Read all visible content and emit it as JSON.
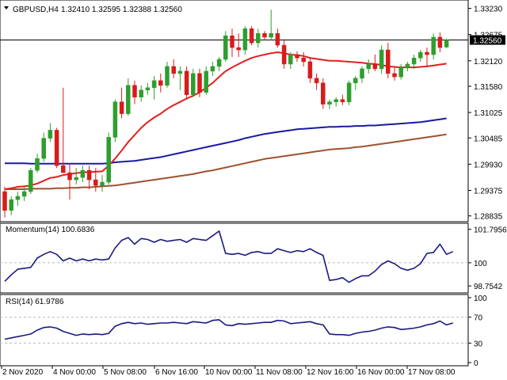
{
  "header": {
    "symbol_timeframe": "GBPUSD,H4",
    "ohlc": "1.32410 1.32595 1.32388 1.32560"
  },
  "price_axis": {
    "ticks": [
      "1.33230",
      "1.32675",
      "1.32120",
      "1.31580",
      "1.31025",
      "1.30485",
      "1.29930",
      "1.29375",
      "1.28835"
    ],
    "current_price": "1.32560"
  },
  "momentum": {
    "label": "Momentum(14) 100.6836",
    "ticks": [
      "101.7956",
      "100",
      "98.7542"
    ]
  },
  "rsi": {
    "label": "RSI(14) 61.9786",
    "ticks": [
      "100",
      "70",
      "30",
      "0"
    ]
  },
  "time_axis": {
    "labels": [
      "2 Nov 2020",
      "4 Nov 00:00",
      "5 Nov 08:00",
      "6 Nov 16:00",
      "10 Nov 00:00",
      "11 Nov 08:00",
      "12 Nov 16:00",
      "16 Nov 00:00",
      "17 Nov 08:00"
    ]
  },
  "colors": {
    "bull": "#2e9e2e",
    "bear": "#d81b1b",
    "sma_fast": "#e02020",
    "sma_mid": "#1a1aa0",
    "sma_slow": "#a0522d",
    "indicator": "#1a1a80",
    "grid": "#bbbbbb"
  },
  "chart_data": {
    "type": "candlestick",
    "price_scale": {
      "min": 1.2878,
      "max": 1.3334
    },
    "candles": [
      {
        "o": 1.2935,
        "h": 1.2945,
        "l": 1.288,
        "c": 1.2895
      },
      {
        "o": 1.2895,
        "h": 1.2925,
        "l": 1.2885,
        "c": 1.2918
      },
      {
        "o": 1.2918,
        "h": 1.2935,
        "l": 1.2905,
        "c": 1.2925
      },
      {
        "o": 1.2925,
        "h": 1.2945,
        "l": 1.2915,
        "c": 1.2935
      },
      {
        "o": 1.2935,
        "h": 1.2985,
        "l": 1.293,
        "c": 1.298
      },
      {
        "o": 1.298,
        "h": 1.3015,
        "l": 1.2975,
        "c": 1.3005
      },
      {
        "o": 1.3005,
        "h": 1.306,
        "l": 1.2998,
        "c": 1.3048
      },
      {
        "o": 1.3048,
        "h": 1.308,
        "l": 1.304,
        "c": 1.3065
      },
      {
        "o": 1.3065,
        "h": 1.307,
        "l": 1.2985,
        "c": 1.299
      },
      {
        "o": 1.299,
        "h": 1.3155,
        "l": 1.2975,
        "c": 1.2975
      },
      {
        "o": 1.2975,
        "h": 1.2995,
        "l": 1.2918,
        "c": 1.296
      },
      {
        "o": 1.296,
        "h": 1.2985,
        "l": 1.295,
        "c": 1.2965
      },
      {
        "o": 1.2965,
        "h": 1.299,
        "l": 1.2955,
        "c": 1.298
      },
      {
        "o": 1.298,
        "h": 1.299,
        "l": 1.294,
        "c": 1.296
      },
      {
        "o": 1.296,
        "h": 1.2985,
        "l": 1.2935,
        "c": 1.2948
      },
      {
        "o": 1.2948,
        "h": 1.297,
        "l": 1.2935,
        "c": 1.2955
      },
      {
        "o": 1.2955,
        "h": 1.306,
        "l": 1.295,
        "c": 1.305
      },
      {
        "o": 1.305,
        "h": 1.313,
        "l": 1.304,
        "c": 1.3125
      },
      {
        "o": 1.3125,
        "h": 1.3155,
        "l": 1.309,
        "c": 1.31
      },
      {
        "o": 1.31,
        "h": 1.3175,
        "l": 1.3095,
        "c": 1.316
      },
      {
        "o": 1.316,
        "h": 1.317,
        "l": 1.312,
        "c": 1.3135
      },
      {
        "o": 1.3135,
        "h": 1.316,
        "l": 1.3125,
        "c": 1.315
      },
      {
        "o": 1.315,
        "h": 1.3165,
        "l": 1.314,
        "c": 1.3155
      },
      {
        "o": 1.3155,
        "h": 1.318,
        "l": 1.313,
        "c": 1.317
      },
      {
        "o": 1.317,
        "h": 1.3185,
        "l": 1.3145,
        "c": 1.316
      },
      {
        "o": 1.316,
        "h": 1.321,
        "l": 1.3155,
        "c": 1.32
      },
      {
        "o": 1.32,
        "h": 1.3215,
        "l": 1.3175,
        "c": 1.3185
      },
      {
        "o": 1.3185,
        "h": 1.32,
        "l": 1.315,
        "c": 1.319
      },
      {
        "o": 1.319,
        "h": 1.32,
        "l": 1.313,
        "c": 1.314
      },
      {
        "o": 1.314,
        "h": 1.3195,
        "l": 1.3135,
        "c": 1.3185
      },
      {
        "o": 1.3185,
        "h": 1.3195,
        "l": 1.3135,
        "c": 1.3145
      },
      {
        "o": 1.3145,
        "h": 1.32,
        "l": 1.314,
        "c": 1.319
      },
      {
        "o": 1.319,
        "h": 1.321,
        "l": 1.318,
        "c": 1.32
      },
      {
        "o": 1.32,
        "h": 1.322,
        "l": 1.319,
        "c": 1.3215
      },
      {
        "o": 1.3215,
        "h": 1.3275,
        "l": 1.321,
        "c": 1.3265
      },
      {
        "o": 1.3265,
        "h": 1.328,
        "l": 1.322,
        "c": 1.324
      },
      {
        "o": 1.324,
        "h": 1.327,
        "l": 1.322,
        "c": 1.3235
      },
      {
        "o": 1.3235,
        "h": 1.3285,
        "l": 1.3225,
        "c": 1.328
      },
      {
        "o": 1.328,
        "h": 1.3285,
        "l": 1.3245,
        "c": 1.325
      },
      {
        "o": 1.325,
        "h": 1.328,
        "l": 1.324,
        "c": 1.327
      },
      {
        "o": 1.327,
        "h": 1.3275,
        "l": 1.3255,
        "c": 1.3262
      },
      {
        "o": 1.3262,
        "h": 1.332,
        "l": 1.3255,
        "c": 1.327
      },
      {
        "o": 1.327,
        "h": 1.328,
        "l": 1.324,
        "c": 1.3245
      },
      {
        "o": 1.3245,
        "h": 1.3255,
        "l": 1.3195,
        "c": 1.3205
      },
      {
        "o": 1.3205,
        "h": 1.323,
        "l": 1.3195,
        "c": 1.3225
      },
      {
        "o": 1.3225,
        "h": 1.3232,
        "l": 1.321,
        "c": 1.3218
      },
      {
        "o": 1.3218,
        "h": 1.323,
        "l": 1.32,
        "c": 1.321
      },
      {
        "o": 1.321,
        "h": 1.322,
        "l": 1.3165,
        "c": 1.3175
      },
      {
        "o": 1.3175,
        "h": 1.3185,
        "l": 1.315,
        "c": 1.3165
      },
      {
        "o": 1.3165,
        "h": 1.3175,
        "l": 1.311,
        "c": 1.312
      },
      {
        "o": 1.312,
        "h": 1.313,
        "l": 1.311,
        "c": 1.3125
      },
      {
        "o": 1.3125,
        "h": 1.3135,
        "l": 1.3115,
        "c": 1.313
      },
      {
        "o": 1.313,
        "h": 1.314,
        "l": 1.3118,
        "c": 1.3125
      },
      {
        "o": 1.3125,
        "h": 1.317,
        "l": 1.3118,
        "c": 1.3165
      },
      {
        "o": 1.3165,
        "h": 1.318,
        "l": 1.315,
        "c": 1.3175
      },
      {
        "o": 1.3175,
        "h": 1.32,
        "l": 1.3165,
        "c": 1.3195
      },
      {
        "o": 1.3195,
        "h": 1.3215,
        "l": 1.3185,
        "c": 1.3205
      },
      {
        "o": 1.3205,
        "h": 1.3225,
        "l": 1.319,
        "c": 1.3195
      },
      {
        "o": 1.3195,
        "h": 1.3245,
        "l": 1.3185,
        "c": 1.3235
      },
      {
        "o": 1.3235,
        "h": 1.325,
        "l": 1.3175,
        "c": 1.3185
      },
      {
        "o": 1.3185,
        "h": 1.32,
        "l": 1.317,
        "c": 1.3178
      },
      {
        "o": 1.3178,
        "h": 1.3205,
        "l": 1.3172,
        "c": 1.3198
      },
      {
        "o": 1.3198,
        "h": 1.321,
        "l": 1.319,
        "c": 1.3205
      },
      {
        "o": 1.3205,
        "h": 1.3225,
        "l": 1.3195,
        "c": 1.3218
      },
      {
        "o": 1.3218,
        "h": 1.3235,
        "l": 1.321,
        "c": 1.323
      },
      {
        "o": 1.323,
        "h": 1.324,
        "l": 1.32,
        "c": 1.3225
      },
      {
        "o": 1.3225,
        "h": 1.327,
        "l": 1.3215,
        "c": 1.3262
      },
      {
        "o": 1.3262,
        "h": 1.3272,
        "l": 1.323,
        "c": 1.324
      },
      {
        "o": 1.3241,
        "h": 1.32595,
        "l": 1.32388,
        "c": 1.3256
      }
    ],
    "sma_fast": [
      1.294,
      1.2942,
      1.2945,
      1.2946,
      1.2948,
      1.2952,
      1.2958,
      1.2964,
      1.2966,
      1.297,
      1.2972,
      1.2974,
      1.2976,
      1.2976,
      1.2977,
      1.2978,
      1.299,
      1.3005,
      1.3022,
      1.304,
      1.3055,
      1.307,
      1.3082,
      1.3092,
      1.31,
      1.311,
      1.3118,
      1.3125,
      1.3132,
      1.3138,
      1.3145,
      1.3155,
      1.3165,
      1.3178,
      1.319,
      1.3198,
      1.3205,
      1.3212,
      1.3218,
      1.3222,
      1.3225,
      1.3228,
      1.323,
      1.3228,
      1.3225,
      1.3224,
      1.3222,
      1.3218,
      1.3216,
      1.3214,
      1.3212,
      1.3212,
      1.3211,
      1.321,
      1.3209,
      1.3208,
      1.3206,
      1.3205,
      1.3203,
      1.32,
      1.3199,
      1.3198,
      1.3198,
      1.3198,
      1.3199,
      1.32,
      1.3202,
      1.3204,
      1.3206
    ],
    "sma_mid": [
      1.2995,
      1.2995,
      1.2995,
      1.2995,
      1.2994,
      1.2994,
      1.2994,
      1.2994,
      1.2994,
      1.2994,
      1.2994,
      1.2994,
      1.2994,
      1.2994,
      1.2994,
      1.2994,
      1.2995,
      1.2997,
      1.2998,
      1.2999,
      1.3,
      1.3002,
      1.3004,
      1.3006,
      1.3008,
      1.3011,
      1.3014,
      1.3017,
      1.302,
      1.3023,
      1.3026,
      1.3029,
      1.3032,
      1.3035,
      1.3038,
      1.3041,
      1.3044,
      1.3048,
      1.3051,
      1.3054,
      1.3057,
      1.3059,
      1.3061,
      1.3063,
      1.3065,
      1.3067,
      1.3068,
      1.3069,
      1.307,
      1.3071,
      1.3072,
      1.3072,
      1.3073,
      1.3073,
      1.3074,
      1.3074,
      1.3075,
      1.3075,
      1.3076,
      1.3077,
      1.3078,
      1.3079,
      1.308,
      1.3081,
      1.3082,
      1.3084,
      1.3086,
      1.3088,
      1.309
    ],
    "sma_slow": [
      1.294,
      1.294,
      1.294,
      1.294,
      1.2941,
      1.2941,
      1.2941,
      1.2941,
      1.2942,
      1.2942,
      1.2943,
      1.2943,
      1.2944,
      1.2944,
      1.2945,
      1.2946,
      1.2947,
      1.2948,
      1.295,
      1.2952,
      1.2954,
      1.2956,
      1.2958,
      1.296,
      1.2962,
      1.2964,
      1.2966,
      1.2968,
      1.297,
      1.2972,
      1.2975,
      1.2978,
      1.298,
      1.2983,
      1.2986,
      1.2989,
      1.2992,
      1.2995,
      1.2998,
      1.3001,
      1.3004,
      1.3006,
      1.3008,
      1.301,
      1.3012,
      1.3014,
      1.3016,
      1.3018,
      1.302,
      1.3022,
      1.3024,
      1.3025,
      1.3026,
      1.3027,
      1.3029,
      1.303,
      1.3032,
      1.3034,
      1.3036,
      1.3038,
      1.304,
      1.3042,
      1.3044,
      1.3046,
      1.3048,
      1.305,
      1.3052,
      1.3054,
      1.3056
    ],
    "momentum_scale": {
      "min": 98.55,
      "max": 101.95
    },
    "momentum": [
      99.0,
      99.35,
      99.65,
      99.7,
      99.75,
      100.25,
      100.45,
      100.6,
      100.45,
      100.1,
      100.25,
      100.1,
      100.2,
      100.1,
      100.2,
      100.15,
      100.2,
      100.8,
      101.2,
      101.35,
      101.0,
      101.3,
      101.25,
      101.1,
      101.25,
      101.15,
      101.2,
      101.25,
      101.1,
      101.3,
      101.25,
      101.2,
      101.45,
      101.7,
      100.5,
      100.45,
      100.5,
      100.4,
      100.55,
      100.6,
      100.5,
      100.5,
      100.75,
      100.65,
      100.55,
      100.65,
      100.6,
      100.75,
      100.55,
      100.4,
      99.05,
      99.1,
      99.2,
      98.95,
      99.15,
      99.3,
      99.3,
      99.55,
      99.9,
      100.1,
      99.95,
      99.7,
      99.6,
      99.7,
      99.95,
      100.5,
      100.55,
      101.0,
      100.45,
      100.6
    ],
    "rsi_scale": {
      "min": 0,
      "max": 100
    },
    "rsi": [
      36,
      38,
      40,
      42,
      44,
      50,
      54,
      55,
      53,
      48,
      45,
      42,
      44,
      43,
      44,
      43,
      45,
      56,
      60,
      62,
      60,
      61,
      59,
      60,
      61,
      61,
      62,
      61,
      60,
      63,
      62,
      61,
      65,
      66,
      58,
      57,
      60,
      59,
      60,
      61,
      62,
      62,
      65,
      64,
      60,
      61,
      62,
      63,
      60,
      58,
      44,
      43,
      43,
      42,
      45,
      47,
      48,
      50,
      53,
      55,
      54,
      51,
      52,
      53,
      55,
      58,
      60,
      64,
      58,
      61
    ]
  }
}
